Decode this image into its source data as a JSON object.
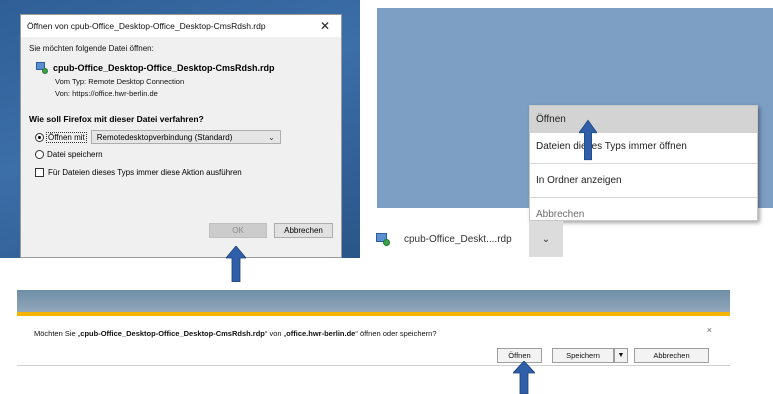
{
  "firefox_dialog": {
    "title": "Öffnen von cpub-Office_Desktop-Office_Desktop-CmsRdsh.rdp",
    "close_glyph": "✕",
    "question": "Sie möchten folgende Datei öffnen:",
    "file_name": "cpub-Office_Desktop-Office_Desktop-CmsRdsh.rdp",
    "type_label": "Vom Typ:",
    "type_value": "Remote Desktop Connection",
    "source_label": "Von:",
    "source_value": "https://office.hwr-berlin.de",
    "section_heading": "Wie soll Firefox mit dieser Datei verfahren?",
    "open_with_label": "Öffnen mit",
    "open_with_app": "Remotedesktopverbindung (Standard)",
    "save_file_label": "Datei speichern",
    "always_label": "Für Dateien dieses Typs immer diese Aktion ausführen",
    "ok_label": "OK",
    "cancel_label": "Abbrechen"
  },
  "context_menu": {
    "items": [
      {
        "label": "Öffnen"
      },
      {
        "label": "Dateien dieses Typs immer öffnen"
      },
      {
        "label": "In Ordner anzeigen"
      },
      {
        "label": "Abbrechen"
      }
    ]
  },
  "download_item": {
    "name": "cpub-Office_Deskt....rdp",
    "menu_glyph": "⌄"
  },
  "ie_notification": {
    "msg_prefix": "Möchten Sie „",
    "msg_file": "cpub-Office_Desktop-Office_Desktop-CmsRdsh.rdp",
    "msg_middle": "“ von „",
    "msg_host": "office.hwr-berlin.de",
    "msg_suffix": "“ öffnen oder speichern?",
    "open_label": "Öffnen",
    "save_label": "Speichern",
    "dropdown_glyph": "▼",
    "cancel_label": "Abbrechen",
    "close_glyph": "×"
  },
  "colors": {
    "arrow": "#2f5fa8",
    "notification_accent": "#f4b400",
    "desktop_blue": "#3c6ea8"
  }
}
